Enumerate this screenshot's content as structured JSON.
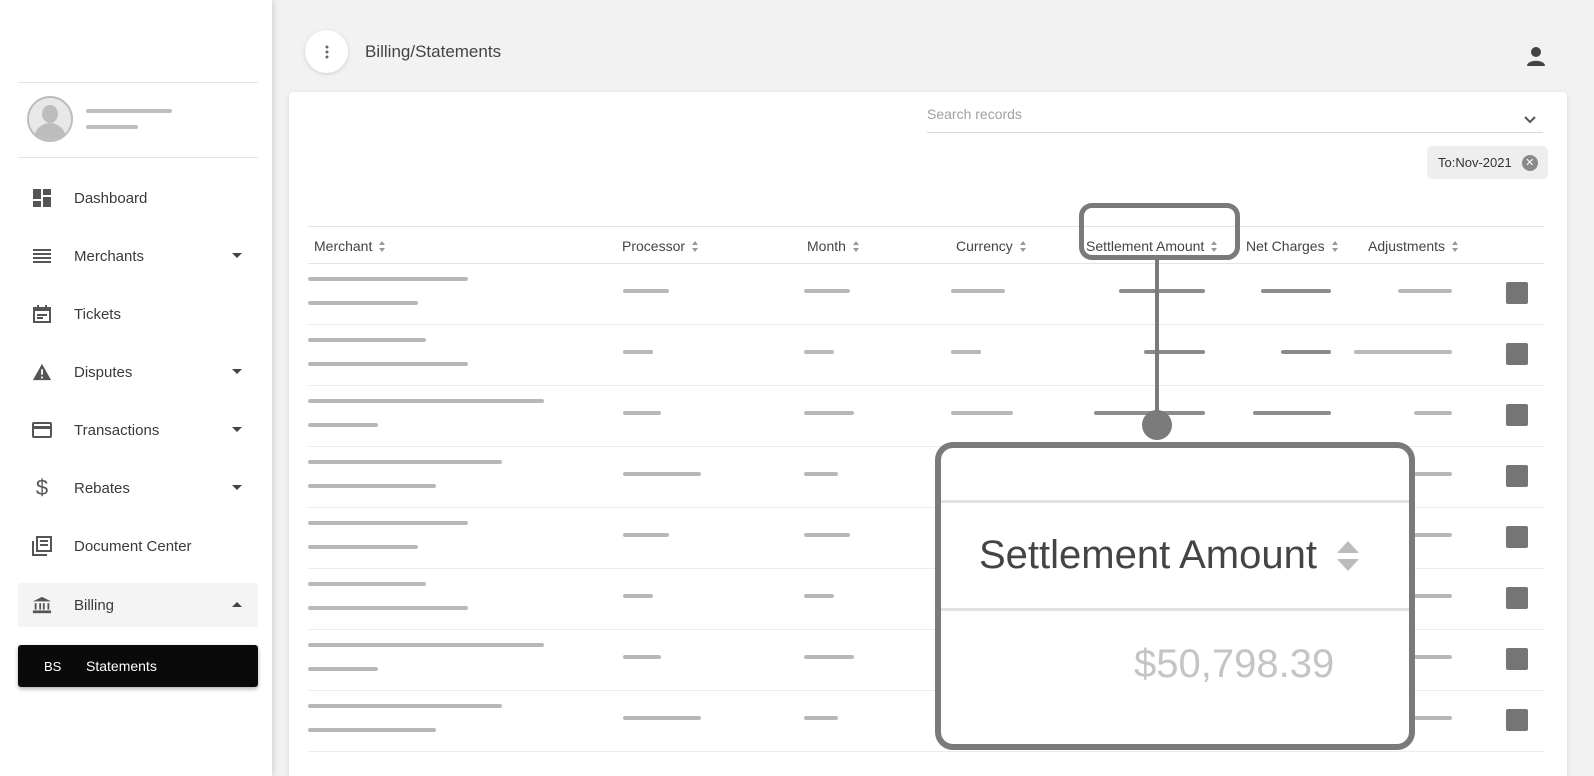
{
  "sidebar": {
    "items": [
      {
        "label": "Dashboard",
        "icon": "dashboard-icon",
        "has_caret": false
      },
      {
        "label": "Merchants",
        "icon": "list-icon",
        "has_caret": true
      },
      {
        "label": "Tickets",
        "icon": "calendar-icon",
        "has_caret": false
      },
      {
        "label": "Disputes",
        "icon": "warning-icon",
        "has_caret": true
      },
      {
        "label": "Transactions",
        "icon": "credit-card-icon",
        "has_caret": true
      },
      {
        "label": "Rebates",
        "icon": "dollar-icon",
        "has_caret": true
      },
      {
        "label": "Document Center",
        "icon": "library-books-icon",
        "has_caret": false
      },
      {
        "label": "Billing",
        "icon": "bank-icon",
        "has_caret": true,
        "expanded": true
      }
    ],
    "sub_item": {
      "abbr": "BS",
      "label": "Statements"
    }
  },
  "header": {
    "title": "Billing/Statements",
    "menu_icon": "more-vert-icon",
    "profile_icon": "person-icon"
  },
  "search": {
    "placeholder": "Search records"
  },
  "filter_chip": {
    "label": "To:Nov-2021"
  },
  "table": {
    "columns": [
      "Merchant",
      "Processor",
      "Month",
      "Currency",
      "Settlement Amount",
      "Net Charges",
      "Adjustments"
    ],
    "row_count": 8
  },
  "callout": {
    "header": "Settlement Amount",
    "value": "$50,798.39"
  },
  "colors": {
    "sidebar_active_sub": "#0a0a0a",
    "callout_border": "#7a7a7a",
    "background": "#f2f2f2"
  }
}
